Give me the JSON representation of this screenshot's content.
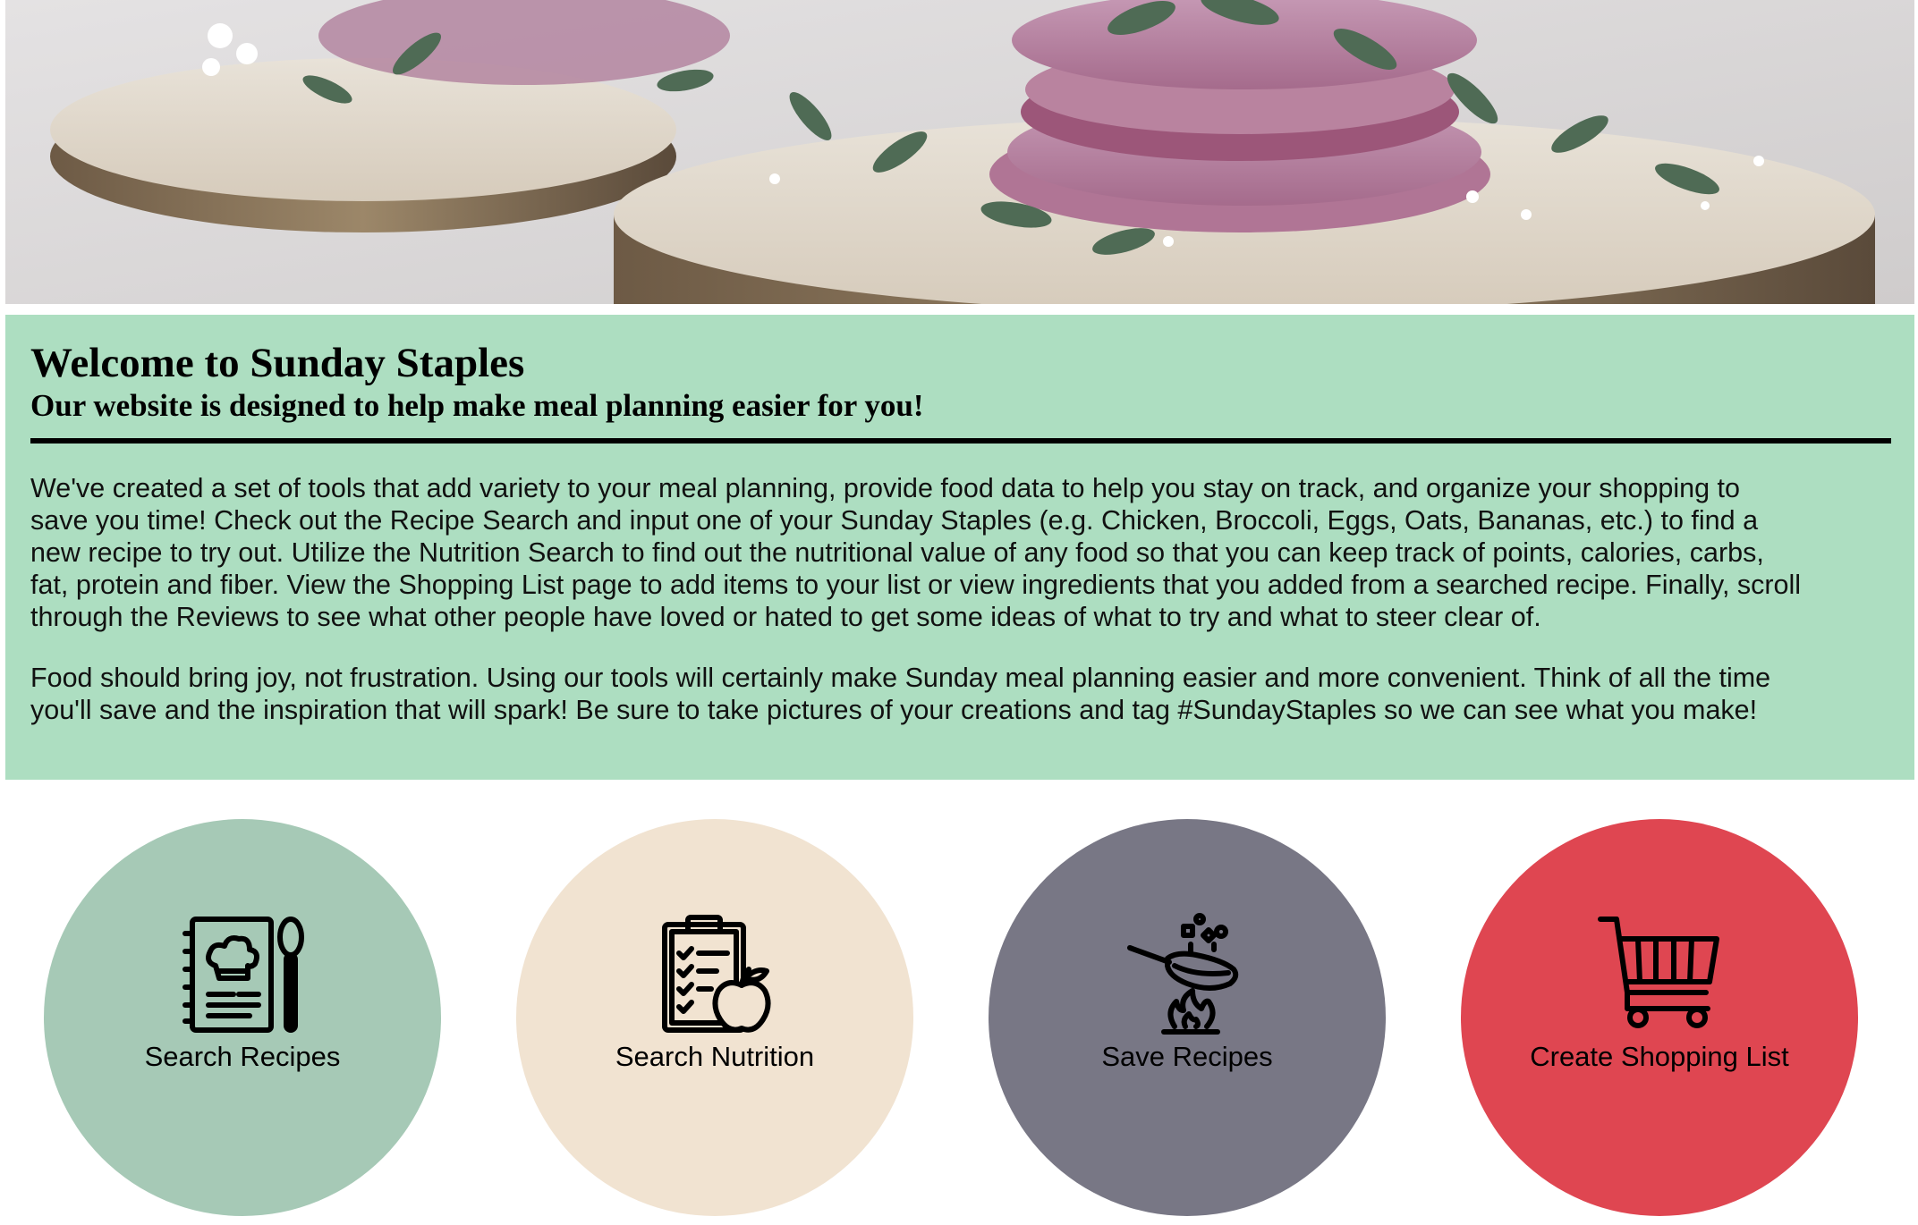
{
  "hero": {
    "image": "macaron-on-wood-slices-photo"
  },
  "welcome": {
    "title": "Welcome to Sunday Staples",
    "subtitle": "Our website is designed to help make meal planning easier for you!",
    "paragraph1_lines": [
      "We've created a set of tools that add variety to your meal planning, provide food data to help you stay on track, and organize your shopping to",
      "save you time! Check out the Recipe Search and input one of your Sunday Staples (e.g. Chicken, Broccoli, Eggs, Oats, Bananas, etc.) to find a",
      "new recipe to try out. Utilize the Nutrition Search to find out the nutritional value of any food so that you can keep track of points, calories, carbs,",
      "fat, protein and fiber. View the Shopping List page to add items to your list or view ingredients that you added from a searched recipe. Finally, scroll",
      "through the Reviews to see what other people have loved or hated to get some ideas of what to try and what to steer clear of."
    ],
    "paragraph2_lines": [
      "Food should bring joy, not frustration. Using our tools will certainly make Sunday meal planning easier and more convenient. Think of all the time",
      "you'll save and the inspiration that will spark! Be sure to take pictures of your creations and tag #SundayStaples so we can see what you make!"
    ]
  },
  "tiles": [
    {
      "label": "Search Recipes",
      "icon": "recipe-book-icon",
      "color": "#a6c9b6"
    },
    {
      "label": "Search Nutrition",
      "icon": "nutrition-clipboard-icon",
      "color": "#f1e3d1"
    },
    {
      "label": "Save Recipes",
      "icon": "frying-pan-icon",
      "color": "#787785"
    },
    {
      "label": "Create Shopping List",
      "icon": "shopping-cart-icon",
      "color": "#df4651"
    }
  ],
  "colors": {
    "welcome_bg": "#addec1",
    "divider": "#000000"
  }
}
